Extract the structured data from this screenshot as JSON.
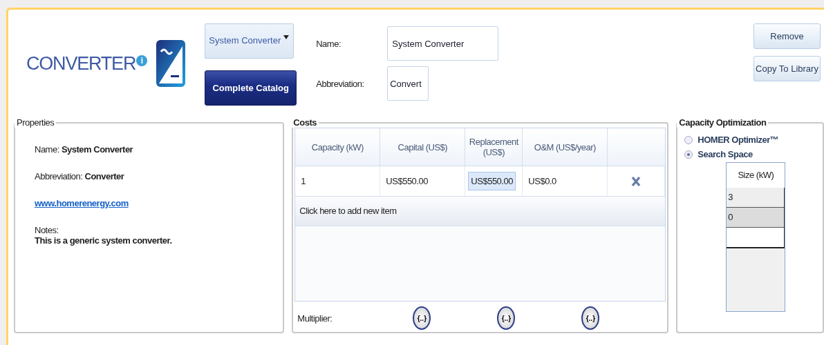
{
  "header": {
    "title": "CONVERTER",
    "info_badge": "i",
    "type_dropdown": {
      "value": "System Converter"
    },
    "catalog_button": "Complete Catalog",
    "name_label": "Name:",
    "name_value": "System Converter",
    "abbreviation_label": "Abbreviation:",
    "abbreviation_value": "Convert",
    "buttons": [
      "Remove",
      "Copy To Library"
    ]
  },
  "properties": {
    "title": "Properties",
    "lines": [
      "Name: **System Converter**",
      "Abbreviation: **Converter**"
    ],
    "link": "www.homerenergy.com",
    "notes_label": "Notes:",
    "notes": "This is a generic system converter."
  },
  "costs": {
    "title": "Costs",
    "columns": [
      {
        "label": "Capacity (kW)"
      },
      {
        "label": "Capital (US$)"
      },
      {
        "label": "Replacement (US$)"
      },
      {
        "label": "O&M (US$/year)"
      }
    ],
    "rows": [
      {
        "cells": [
          {
            "text": "1",
            "selected": false
          },
          {
            "text": "US$550.00",
            "selected": false
          },
          {
            "text": "US$550.00",
            "selected": true
          },
          {
            "text": "US$0.0",
            "selected": false
          }
        ]
      }
    ],
    "add_row": "Click here to add new item",
    "multiplier_label": "Multiplier:",
    "multiplier_buttons": [
      "{..}",
      "{..}",
      "{..}"
    ]
  },
  "capacity_optimization": {
    "title": "Capacity Optimization",
    "options": [
      {
        "label": "HOMER Optimizer™",
        "selected": false
      },
      {
        "label": "Search Space",
        "selected": true
      }
    ],
    "size_header": "Size (kW)",
    "sizes": [
      {
        "value": "3",
        "selected": false
      },
      {
        "value": "0",
        "selected": true
      }
    ]
  }
}
